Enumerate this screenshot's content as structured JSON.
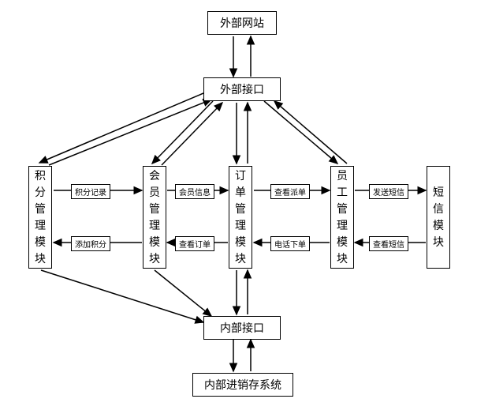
{
  "chart_data": {
    "type": "diagram",
    "nodes": [
      {
        "id": "ext_site",
        "label": "外部网站"
      },
      {
        "id": "ext_if",
        "label": "外部接口"
      },
      {
        "id": "points",
        "label": "积分管理模块"
      },
      {
        "id": "member",
        "label": "会员管理模块"
      },
      {
        "id": "order",
        "label": "订单管理模块"
      },
      {
        "id": "staff",
        "label": "员工管理模块"
      },
      {
        "id": "sms",
        "label": "短信模块"
      },
      {
        "id": "int_if",
        "label": "内部接口"
      },
      {
        "id": "int_sys",
        "label": "内部进销存系统"
      }
    ],
    "edges": [
      {
        "from": "ext_site",
        "to": "ext_if",
        "dir": "both"
      },
      {
        "from": "ext_if",
        "to": "points",
        "dir": "both"
      },
      {
        "from": "ext_if",
        "to": "member",
        "dir": "both"
      },
      {
        "from": "ext_if",
        "to": "order",
        "dir": "both"
      },
      {
        "from": "ext_if",
        "to": "staff",
        "dir": "both"
      },
      {
        "from": "points",
        "to": "member",
        "label_fwd": "积分记录",
        "label_back": "添加积分"
      },
      {
        "from": "member",
        "to": "order",
        "label_fwd": "会员信息",
        "label_back": "查看订单"
      },
      {
        "from": "order",
        "to": "staff",
        "label_fwd": "查看派单",
        "label_back": "电话下单"
      },
      {
        "from": "staff",
        "to": "sms",
        "label_fwd": "发送短信",
        "label_back": "查看短信"
      },
      {
        "from": "points",
        "to": "int_if",
        "dir": "fwd"
      },
      {
        "from": "member",
        "to": "int_if",
        "dir": "fwd"
      },
      {
        "from": "order",
        "to": "int_if",
        "dir": "both"
      },
      {
        "from": "int_if",
        "to": "int_sys",
        "dir": "both"
      }
    ]
  },
  "n": {
    "ext_site": "外部网站",
    "ext_if": "外部接口",
    "points": "积分管理模块",
    "member": "会员管理模块",
    "order": "订单管理模块",
    "staff": "员工管理模块",
    "sms": "短信模块",
    "int_if": "内部接口",
    "int_sys": "内部进销存系统"
  },
  "e": {
    "pm_fwd": "积分记录",
    "pm_back": "添加积分",
    "mo_fwd": "会员信息",
    "mo_back": "查看订单",
    "os_fwd": "查看派单",
    "os_back": "电话下单",
    "sm_fwd": "发送短信",
    "sm_back": "查看短信"
  }
}
